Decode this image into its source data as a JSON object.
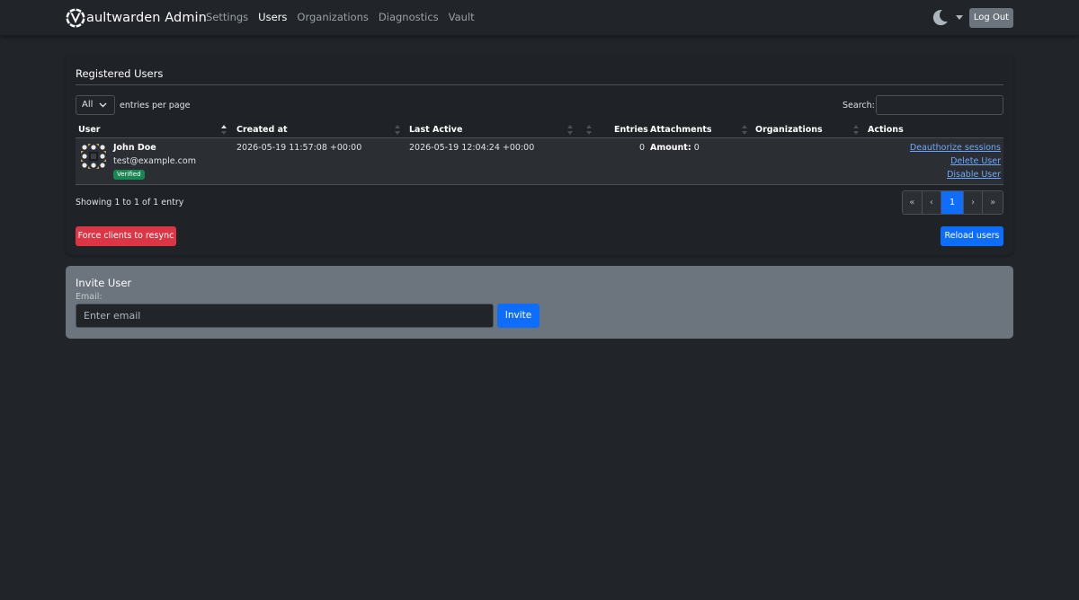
{
  "nav": {
    "brand": "aultwarden Admin",
    "links": [
      "Settings",
      "Users",
      "Organizations",
      "Diagnostics",
      "Vault"
    ],
    "active": "Users",
    "logout": "Log Out"
  },
  "users_panel": {
    "title": "Registered Users",
    "per_page_value": "All",
    "per_page_label": "entries per page",
    "search_label": "Search:",
    "search_value": "",
    "columns": [
      "User",
      "Created at",
      "Last Active",
      "Entries",
      "Attachments",
      "Organizations",
      "Actions"
    ],
    "rows": [
      {
        "name": "John Doe",
        "email": "test@example.com",
        "badge": "Verified",
        "created_at": "2026-05-19 11:57:08 +00:00",
        "last_active": "2026-05-19 12:04:24 +00:00",
        "entries": "0",
        "attachments_label": "Amount:",
        "attachments_value": "0",
        "organizations": "",
        "actions": [
          "Deauthorize sessions",
          "Delete User",
          "Disable User"
        ]
      }
    ],
    "info": "Showing 1 to 1 of 1 entry",
    "pagination": [
      "«",
      "‹",
      "1",
      "›",
      "»"
    ],
    "current_page": "1",
    "resync_button": "Force clients to resync",
    "reload_button": "Reload users"
  },
  "invite": {
    "title": "Invite User",
    "email_label": "Email:",
    "email_placeholder": "Enter email",
    "email_value": "",
    "button": "Invite"
  },
  "colors": {
    "background": "#212529",
    "primary": "#0d6efd",
    "danger": "#dc3545",
    "success": "#198754",
    "secondary": "#6c757d",
    "link": "#6ea8fe"
  },
  "icons": [
    "vaultwarden-logo-icon",
    "moon-icon",
    "caret-down-icon",
    "chevron-down-icon",
    "sort-icon",
    "identicon-avatar"
  ]
}
